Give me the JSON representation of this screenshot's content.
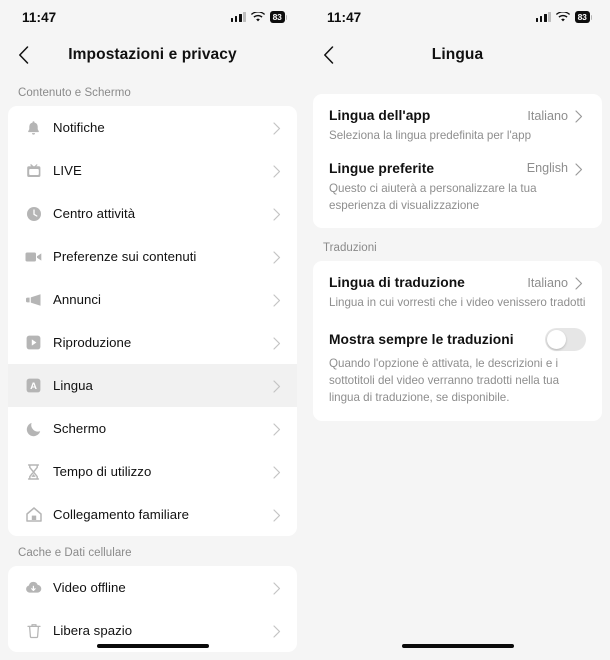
{
  "statusbar": {
    "time": "11:47",
    "battery_level": "83",
    "signal_icon": "cellular-signal-icon",
    "wifi_icon": "wifi-icon",
    "battery_icon": "battery-icon"
  },
  "left_screen": {
    "nav": {
      "back_icon": "back-chevron-icon",
      "title": "Impostazioni e privacy"
    },
    "sections": [
      {
        "header": "Contenuto e Schermo",
        "items": [
          {
            "label": "Notifiche",
            "icon": "bell-icon",
            "selected": false
          },
          {
            "label": "LIVE",
            "icon": "live-tv-icon",
            "selected": false
          },
          {
            "label": "Centro attività",
            "icon": "clock-icon",
            "selected": false
          },
          {
            "label": "Preferenze sui contenuti",
            "icon": "video-camera-icon",
            "selected": false
          },
          {
            "label": "Annunci",
            "icon": "megaphone-icon",
            "selected": false
          },
          {
            "label": "Riproduzione",
            "icon": "play-icon",
            "selected": false
          },
          {
            "label": "Lingua",
            "icon": "letter-a-icon",
            "selected": true
          },
          {
            "label": "Schermo",
            "icon": "moon-icon",
            "selected": false
          },
          {
            "label": "Tempo di utilizzo",
            "icon": "hourglass-icon",
            "selected": false
          },
          {
            "label": "Collegamento familiare",
            "icon": "house-icon",
            "selected": false
          }
        ]
      },
      {
        "header": "Cache e Dati cellulare",
        "items": [
          {
            "label": "Video offline",
            "icon": "cloud-download-icon",
            "selected": false
          },
          {
            "label": "Libera spazio",
            "icon": "trash-icon",
            "selected": false
          }
        ]
      }
    ]
  },
  "right_screen": {
    "nav": {
      "back_icon": "back-chevron-icon",
      "title": "Lingua"
    },
    "sections": [
      {
        "header": "",
        "items": [
          {
            "title": "Lingua dell'app",
            "value": "Italiano",
            "subtitle": "Seleziona la lingua predefinita per l'app",
            "control": "chevron"
          },
          {
            "title": "Lingue preferite",
            "value": "English",
            "subtitle": "Questo ci aiuterà a personalizzare la tua esperienza di visualizzazione",
            "control": "chevron"
          }
        ]
      },
      {
        "header": "Traduzioni",
        "items": [
          {
            "title": "Lingua di traduzione",
            "value": "Italiano",
            "subtitle": "Lingua in cui vorresti che i video venissero tradotti",
            "control": "chevron"
          },
          {
            "title": "Mostra sempre le traduzioni",
            "value": "",
            "subtitle": "Quando l'opzione è attivata, le descrizioni e i sottotitoli del video verranno tradotti nella tua lingua di traduzione, se disponibile.",
            "control": "toggle",
            "toggle_on": false
          }
        ]
      }
    ]
  },
  "colors": {
    "page_bg": "#f5f5f5",
    "card_bg": "#ffffff",
    "selected_row": "#f1f1f1",
    "primary_text": "#111111",
    "secondary_text": "#8e8e8e",
    "icon_gray": "#b5b5b5"
  }
}
